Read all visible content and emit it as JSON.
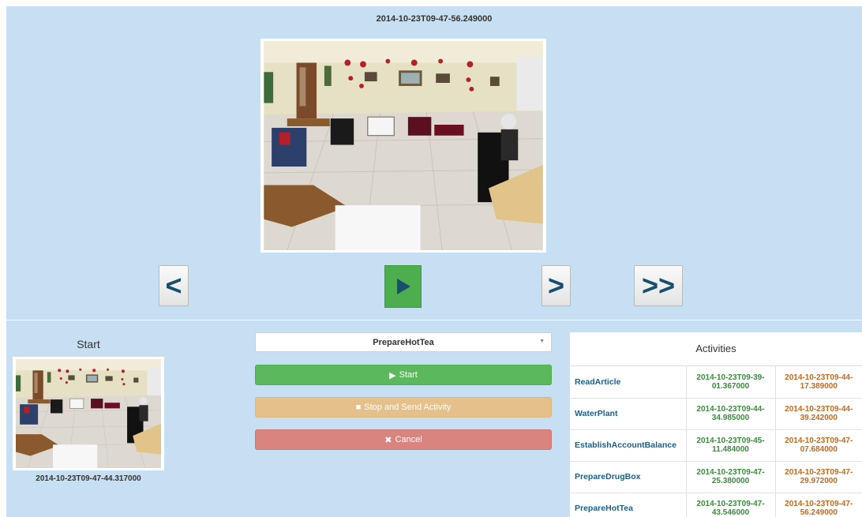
{
  "player": {
    "current_timestamp": "2014-10-23T09-47-56.249000",
    "controls": {
      "prev_label": "<",
      "play_icon": "play-icon",
      "next_label": ">",
      "fast_forward_label": ">>"
    }
  },
  "segment": {
    "start_label": "Start",
    "start_timestamp": "2014-10-23T09-47-44.317000"
  },
  "form": {
    "selected_activity": "PrepareHotTea",
    "start_label": "Start",
    "stop_label": "Stop and Send Activity",
    "cancel_label": "Cancel"
  },
  "activities": {
    "title": "Activities",
    "rows": [
      {
        "name": "ReadArticle",
        "start": "2014-10-23T09-39-01.367000",
        "end": "2014-10-23T09-44-17.389000"
      },
      {
        "name": "WaterPlant",
        "start": "2014-10-23T09-44-34.985000",
        "end": "2014-10-23T09-44-39.242000"
      },
      {
        "name": "EstablishAccountBalance",
        "start": "2014-10-23T09-45-11.484000",
        "end": "2014-10-23T09-47-07.684000"
      },
      {
        "name": "PrepareDrugBox",
        "start": "2014-10-23T09-47-25.380000",
        "end": "2014-10-23T09-47-29.972000"
      },
      {
        "name": "PrepareHotTea",
        "start": "2014-10-23T09-47-43.546000",
        "end": "2014-10-23T09-47-56.249000"
      }
    ]
  },
  "colors": {
    "panel_bg": "#c7dff2",
    "play_green": "#4cae4c",
    "start_green": "#5cb85c",
    "stop_orange": "#e6c08a",
    "cancel_red": "#d9847f",
    "activity_name": "#1d5e87",
    "start_time": "#3c8a3e",
    "end_time": "#c06a22"
  }
}
